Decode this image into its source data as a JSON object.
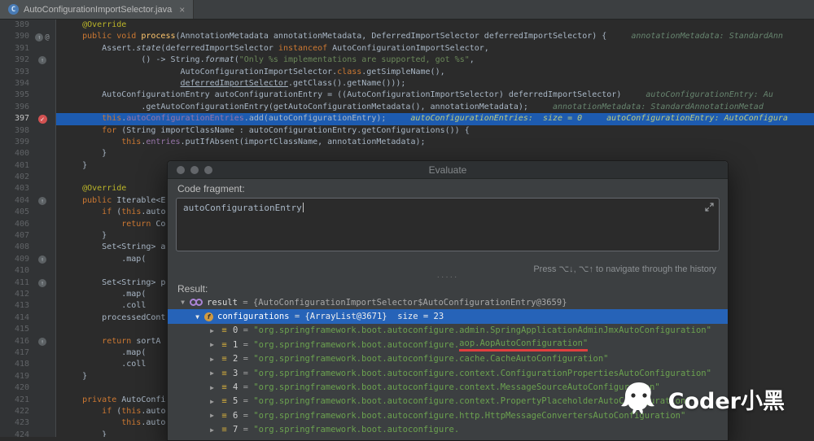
{
  "tab": {
    "title": "AutoConfigurationImportSelector.java",
    "icon_letter": "C",
    "close_glyph": "×"
  },
  "editor": {
    "lines": [
      {
        "num": 389,
        "tokens": [
          [
            "    "
          ],
          [
            "@Override",
            "ann"
          ]
        ]
      },
      {
        "num": 390,
        "icons": [
          "marker",
          "at"
        ],
        "tokens": [
          [
            "    "
          ],
          [
            "public void ",
            "kw"
          ],
          [
            "process",
            "mth"
          ],
          [
            "(AnnotationMetadata annotationMetadata, DeferredImportSelector deferredImportSelector) {"
          ]
        ],
        "hints": [
          "annotationMetadata: StandardAnn"
        ]
      },
      {
        "num": 391,
        "tokens": [
          [
            "        Assert."
          ],
          [
            "state",
            "stat"
          ],
          [
            "(deferredImportSelector "
          ],
          [
            "instanceof",
            "kw"
          ],
          [
            " AutoConfigurationImportSelector,"
          ]
        ]
      },
      {
        "num": 392,
        "icons": [
          "marker"
        ],
        "tokens": [
          [
            "                () -> String."
          ],
          [
            "format",
            "stat"
          ],
          [
            "("
          ],
          [
            "\"Only %s implementations are supported, got %s\"",
            "str"
          ],
          [
            ","
          ]
        ]
      },
      {
        "num": 393,
        "tokens": [
          [
            "                        AutoConfigurationImportSelector."
          ],
          [
            "class",
            "kw"
          ],
          [
            ".getSimpleName(),"
          ]
        ]
      },
      {
        "num": 394,
        "tokens": [
          [
            "                        "
          ],
          [
            "deferredImportSelector",
            "ul"
          ],
          [
            ".getClass().getName()));"
          ]
        ]
      },
      {
        "num": 395,
        "tokens": [
          [
            "        AutoConfigurationEntry autoConfigurationEntry = ((AutoConfigurationImportSelector) deferredImportSelector)"
          ]
        ],
        "hints": [
          "autoConfigurationEntry: Au"
        ]
      },
      {
        "num": 396,
        "tokens": [
          [
            "                .getAutoConfigurationEntry(getAutoConfigurationMetadata(), annotationMetadata);"
          ]
        ],
        "hints": [
          "annotationMetadata: StandardAnnotationMetad"
        ]
      },
      {
        "num": 397,
        "active": true,
        "icons": [
          "breakpoint"
        ],
        "tokens": [
          [
            "        "
          ],
          [
            "this",
            "kw"
          ],
          [
            "."
          ],
          [
            "autoConfigurationEntries",
            "fld"
          ],
          [
            ".add(autoConfigurationEntry);"
          ]
        ],
        "hints": [
          "autoConfigurationEntries:  size = 0",
          "autoConfigurationEntry: AutoConfigura"
        ]
      },
      {
        "num": 398,
        "tokens": [
          [
            "        "
          ],
          [
            "for",
            "kw"
          ],
          [
            " (String importClassName : autoConfigurationEntry.getConfigurations()) {"
          ]
        ]
      },
      {
        "num": 399,
        "tokens": [
          [
            "            "
          ],
          [
            "this",
            "kw"
          ],
          [
            "."
          ],
          [
            "entries",
            "fld"
          ],
          [
            ".putIfAbsent(importClassName, annotationMetadata);"
          ]
        ]
      },
      {
        "num": 400,
        "tokens": [
          [
            "        }"
          ]
        ]
      },
      {
        "num": 401,
        "tokens": [
          [
            "    }"
          ]
        ]
      },
      {
        "num": 402,
        "tokens": []
      },
      {
        "num": 403,
        "tokens": [
          [
            "    "
          ],
          [
            "@Override",
            "ann"
          ]
        ]
      },
      {
        "num": 404,
        "icons": [
          "marker"
        ],
        "tokens": [
          [
            "    "
          ],
          [
            "public ",
            "kw"
          ],
          [
            "Iterable<E"
          ]
        ]
      },
      {
        "num": 405,
        "tokens": [
          [
            "        "
          ],
          [
            "if",
            "kw"
          ],
          [
            " ("
          ],
          [
            "this",
            "kw"
          ],
          [
            ".auto"
          ]
        ]
      },
      {
        "num": 406,
        "tokens": [
          [
            "            "
          ],
          [
            "return",
            "kw"
          ],
          [
            " Co"
          ]
        ]
      },
      {
        "num": 407,
        "tokens": [
          [
            "        }"
          ]
        ]
      },
      {
        "num": 408,
        "tokens": [
          [
            "        Set<String> a"
          ]
        ]
      },
      {
        "num": 409,
        "icons": [
          "marker"
        ],
        "tokens": [
          [
            "            .map("
          ]
        ]
      },
      {
        "num": 410,
        "tokens": []
      },
      {
        "num": 411,
        "icons": [
          "marker"
        ],
        "tokens": [
          [
            "        Set<String> p"
          ]
        ]
      },
      {
        "num": 412,
        "tokens": [
          [
            "            .map("
          ]
        ]
      },
      {
        "num": 413,
        "tokens": [
          [
            "            .coll"
          ]
        ]
      },
      {
        "num": 414,
        "tokens": [
          [
            "        processedCont"
          ]
        ]
      },
      {
        "num": 415,
        "tokens": []
      },
      {
        "num": 416,
        "icons": [
          "marker"
        ],
        "tokens": [
          [
            "        "
          ],
          [
            "return",
            "kw"
          ],
          [
            " sortA"
          ]
        ]
      },
      {
        "num": 417,
        "tokens": [
          [
            "            .map("
          ]
        ]
      },
      {
        "num": 418,
        "tokens": [
          [
            "            .coll"
          ]
        ]
      },
      {
        "num": 419,
        "tokens": [
          [
            "    }"
          ]
        ]
      },
      {
        "num": 420,
        "tokens": []
      },
      {
        "num": 421,
        "tokens": [
          [
            "    "
          ],
          [
            "private",
            "kw"
          ],
          [
            " AutoConfi"
          ]
        ]
      },
      {
        "num": 422,
        "tokens": [
          [
            "        "
          ],
          [
            "if",
            "kw"
          ],
          [
            " ("
          ],
          [
            "this",
            "kw"
          ],
          [
            ".auto"
          ]
        ]
      },
      {
        "num": 423,
        "tokens": [
          [
            "            "
          ],
          [
            "this",
            "kw"
          ],
          [
            ".auto"
          ]
        ]
      },
      {
        "num": 424,
        "tokens": [
          [
            "        }"
          ]
        ]
      }
    ]
  },
  "dialog": {
    "title": "Evaluate",
    "code_fragment_label": "Code fragment:",
    "code_fragment_value": "autoConfigurationEntry",
    "history_hint": "Press ⌥↓, ⌥↑ to navigate through the history",
    "splitter": "·····",
    "result_label": "Result:",
    "tree": {
      "result": {
        "arrow": "▼",
        "name": "result",
        "eq": " = ",
        "value": "{AutoConfigurationImportSelector$AutoConfigurationEntry@3659}"
      },
      "configurations": {
        "arrow": "▼",
        "icon_letter": "f",
        "name": "configurations",
        "eq": " = ",
        "value": "{ArrayList@3671}",
        "size": "size = 23"
      },
      "items": [
        {
          "arrow": "▶",
          "index": "0",
          "eq": " = ",
          "value": "\"org.springframework.boot.autoconfigure.admin.SpringApplicationAdminJmxAutoConfiguration\""
        },
        {
          "arrow": "▶",
          "index": "1",
          "eq": " = ",
          "value_pre": "\"org.springframework.boot.autoconfigure.",
          "value_marked": "aop.AopAutoConfiguration\""
        },
        {
          "arrow": "▶",
          "index": "2",
          "eq": " = ",
          "value": "\"org.springframework.boot.autoconfigure.cache.CacheAutoConfiguration\""
        },
        {
          "arrow": "▶",
          "index": "3",
          "eq": " = ",
          "value": "\"org.springframework.boot.autoconfigure.context.ConfigurationPropertiesAutoConfiguration\""
        },
        {
          "arrow": "▶",
          "index": "4",
          "eq": " = ",
          "value": "\"org.springframework.boot.autoconfigure.context.MessageSourceAutoConfiguration\""
        },
        {
          "arrow": "▶",
          "index": "5",
          "eq": " = ",
          "value": "\"org.springframework.boot.autoconfigure.context.PropertyPlaceholderAutoConfiguration\""
        },
        {
          "arrow": "▶",
          "index": "6",
          "eq": " = ",
          "value": "\"org.springframework.boot.autoconfigure.http.HttpMessageConvertersAutoConfiguration\""
        },
        {
          "arrow": "▶",
          "index": "7",
          "eq": " = ",
          "value": "\"org.springframework.boot.autoconfigure."
        }
      ]
    }
  },
  "watermark": {
    "text": "Coder小黑"
  }
}
